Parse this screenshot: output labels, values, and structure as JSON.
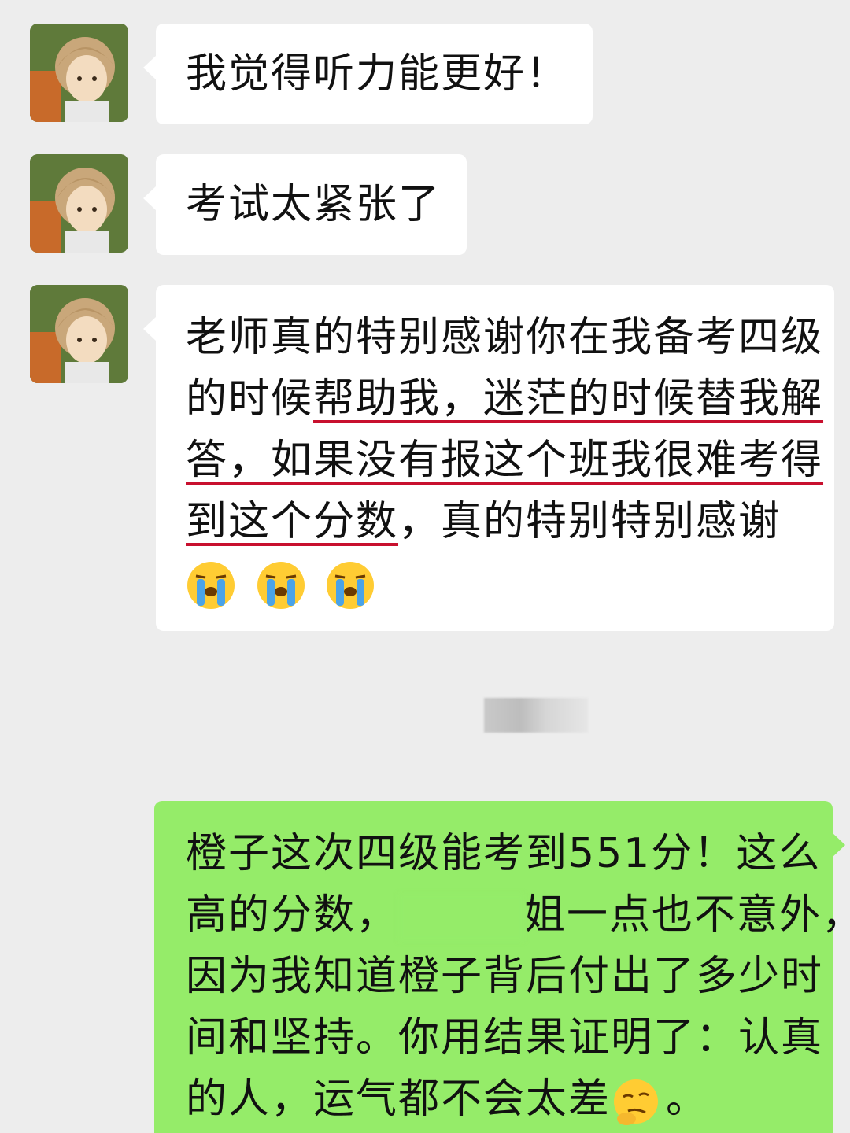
{
  "messages": [
    {
      "sender": "contact",
      "text": "我觉得听力能更好！"
    },
    {
      "sender": "contact",
      "text": "考试太紧张了"
    },
    {
      "sender": "contact",
      "line1": "老师真的特别感谢你在我备考四级",
      "line2_a": "的时候",
      "line2_u": "帮助我，迷茫的时候替我解",
      "line3_u": "答，如果没有报这个班我很难考得",
      "line4_u": "到这个分数",
      "line4_b": "，真的特别特别感谢",
      "emoji": "loudly-crying-face-emoji"
    },
    {
      "sender": "self",
      "line1": "橙子这次四级能考到551分！这么",
      "line2_a": "高的分数，",
      "line2_b": "姐一点也不意外，",
      "line3": "因为我知道橙子背后付出了多少时",
      "line4": "间和坚持。你用结果证明了：认真",
      "line5_a": "的人，运气都不会太差",
      "line5_b": "。",
      "emoji": "thinking-smirk-emoji"
    }
  ],
  "colors": {
    "background": "#ededed",
    "bubble_in": "#ffffff",
    "bubble_out": "#95ec69",
    "underline": "#c8102e"
  }
}
